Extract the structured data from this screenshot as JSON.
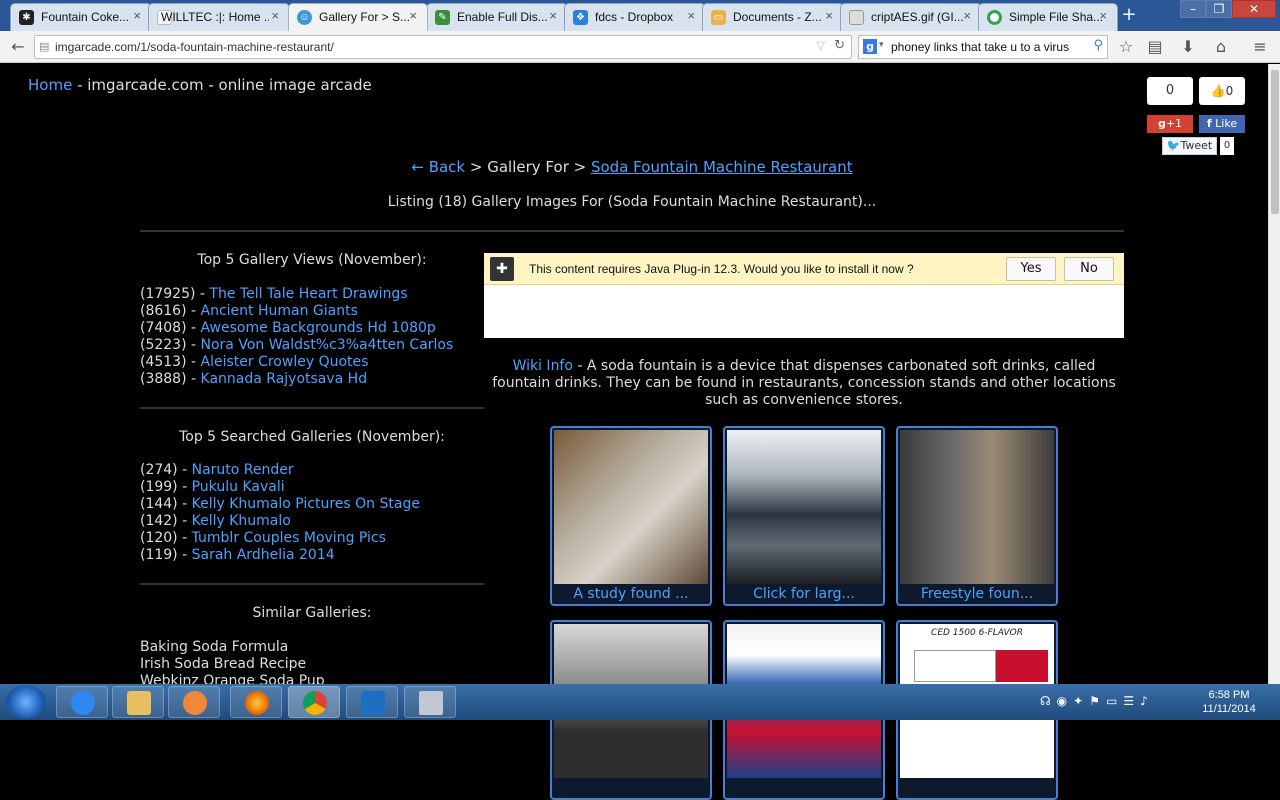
{
  "browser": {
    "tabs": [
      {
        "title": "Fountain Coke...",
        "icon": "spider-icon",
        "color": "#222222"
      },
      {
        "title": "WILLTEC :|: Home ...",
        "icon": "blank-page-icon",
        "color": "#f5f5f5"
      },
      {
        "title": "Gallery For > S...",
        "icon": "smiley-icon",
        "color": "#3a9ad9"
      },
      {
        "title": "Enable Full Dis...",
        "icon": "site-icon",
        "color": "#3b8e3b"
      },
      {
        "title": "fdcs - Dropbox",
        "icon": "dropbox-icon",
        "color": "#2a7fe0"
      },
      {
        "title": "Documents - Z...",
        "icon": "folder-icon",
        "color": "#e8b44a"
      },
      {
        "title": "criptAES.gif (GI...",
        "icon": "image-icon",
        "color": "#dddddd"
      },
      {
        "title": "Simple File Sha...",
        "icon": "circle-icon",
        "color": "#31a34a"
      }
    ],
    "active_tab": 2,
    "url": "imgarcade.com/1/soda-fountain-machine-restaurant/",
    "search_query": "phoney links that take u to a virus"
  },
  "page": {
    "header_link": "Home",
    "header_text": " - imgarcade.com - online image arcade",
    "social": {
      "count": "0",
      "likes": "0",
      "gplus": "+1",
      "fb_like": "Like",
      "tweet": "Tweet",
      "tweet_count": "0"
    },
    "breadcrumb": {
      "back": "← Back",
      "sep": " > Gallery For > ",
      "current": "Soda Fountain Machine Restaurant"
    },
    "listing": "Listing (18) Gallery Images For (Soda Fountain Machine Restaurant)...",
    "top_views": {
      "heading": "Top 5 Gallery Views (November):",
      "items": [
        {
          "count": "(17925) - ",
          "label": "The Tell Tale Heart Drawings"
        },
        {
          "count": "(8616) - ",
          "label": "Ancient Human Giants"
        },
        {
          "count": "(7408) - ",
          "label": "Awesome Backgrounds Hd 1080p"
        },
        {
          "count": "(5223) - ",
          "label": "Nora Von Waldst%c3%a4tten Carlos"
        },
        {
          "count": "(4513) - ",
          "label": "Aleister Crowley Quotes"
        },
        {
          "count": "(3888) - ",
          "label": "Kannada Rajyotsava Hd"
        }
      ]
    },
    "top_searched": {
      "heading": "Top 5 Searched Galleries (November):",
      "items": [
        {
          "count": "(274) - ",
          "label": "Naruto Render"
        },
        {
          "count": "(199) - ",
          "label": "Pukulu Kavali"
        },
        {
          "count": "(144) - ",
          "label": "Kelly Khumalo Pictures On Stage"
        },
        {
          "count": "(142) - ",
          "label": "Kelly Khumalo"
        },
        {
          "count": "(120) - ",
          "label": "Tumblr Couples Moving Pics"
        },
        {
          "count": "(119) - ",
          "label": "Sarah Ardhelia 2014"
        }
      ]
    },
    "similar": {
      "heading": "Similar Galleries:",
      "items": [
        "Baking Soda Formula",
        "Irish Soda Bread Recipe",
        "Webkinz Orange Soda Pup"
      ]
    },
    "java_bar": {
      "message": "This content requires Java Plug-in 12.3. Would you like to install it now ?",
      "yes": "Yes",
      "no": "No"
    },
    "wiki": {
      "link": "Wiki Info",
      "text": " - A soda fountain is a device that dispenses carbonated soft drinks, called fountain drinks. They can be found in restaurants, concession stands and other locations such as convenience stores."
    },
    "thumbnails": [
      {
        "caption": "A study found ..."
      },
      {
        "caption": "Click for larg..."
      },
      {
        "caption": "Freestyle foun..."
      },
      {
        "caption": ""
      },
      {
        "caption": ""
      },
      {
        "caption": "CED 1500 6-FLAVOR"
      }
    ]
  },
  "taskbar": {
    "apps": [
      "start-orb",
      "internet-explorer",
      "file-explorer",
      "media-player",
      "firefox",
      "chrome",
      "lync",
      "window-app"
    ],
    "time": "6:58 PM",
    "date": "11/11/2014"
  }
}
